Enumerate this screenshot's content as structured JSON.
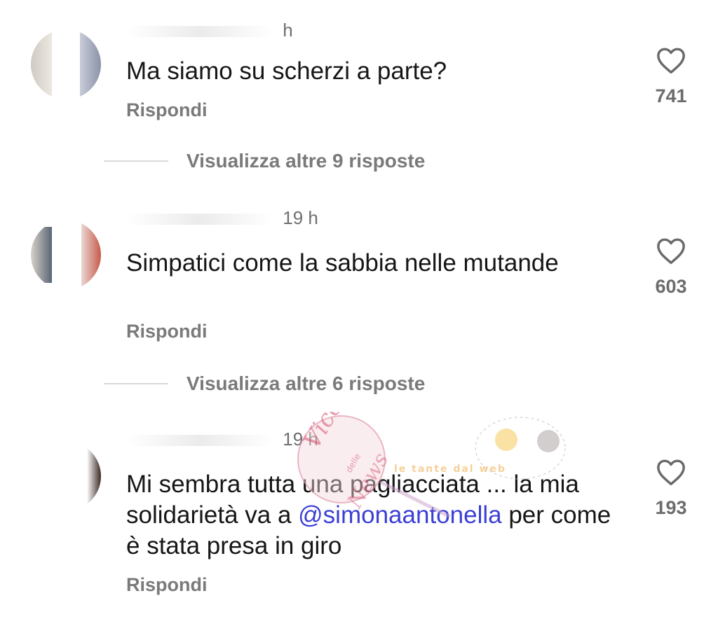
{
  "comments": [
    {
      "time": "h",
      "text": "Ma siamo su scherzi a parte?",
      "reply_label": "Rispondi",
      "likes": "741",
      "view_more": "Visualizza altre 9 risposte"
    },
    {
      "time": "19 h",
      "text": "Simpatici come la sabbia nelle mutande",
      "reply_label": "Rispondi",
      "likes": "603",
      "view_more": "Visualizza altre 6 risposte"
    },
    {
      "time": "19 h",
      "text_before": "Mi sembra tutta una pagliacciata ... la mia solidarietà va a",
      "mention": "@simonaantonella",
      "text_after": "per come è stata presa in giro",
      "reply_label": "Rispondi",
      "likes": "193"
    }
  ],
  "watermark": {
    "line1": "Vicolo",
    "line2": "delle",
    "line3": "News",
    "tagline": "le tante dal web"
  },
  "colors": {
    "text": "#161616",
    "muted": "#7a7a7a",
    "mention": "#3b3fd6"
  },
  "icons": [
    "heart-icon"
  ]
}
